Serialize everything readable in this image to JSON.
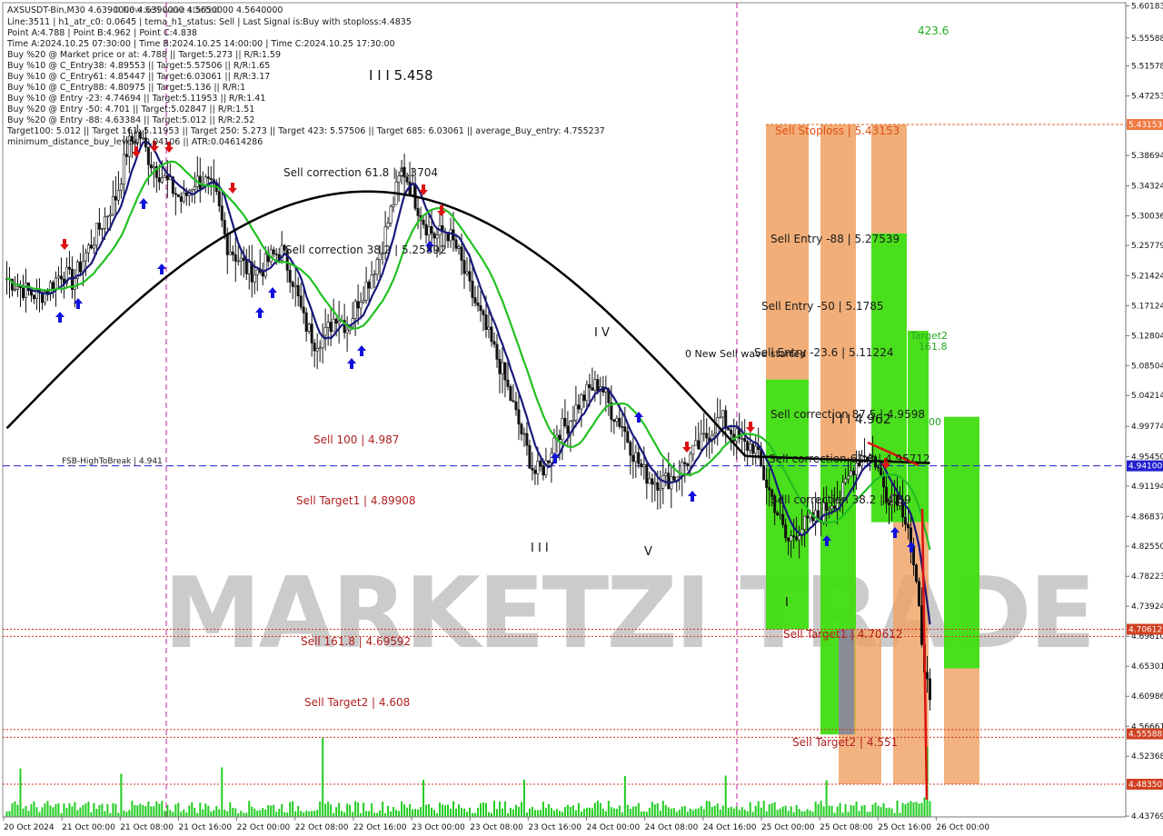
{
  "chart_data": {
    "type": "candlestick",
    "symbol_header": "AXSUSDT-Bin,M30  4.6390000 4.6390000 4.5650000 4.5640000",
    "overlay_title": "0 New Sell wave started",
    "info_lines": [
      "Line:3511 | h1_atr_c0: 0.0645 | tema_h1_status: Sell | Last Signal is:Buy with stoploss:4.4835",
      "Point A:4.788 | Point B:4.962 | Point C:4.838",
      "Time A:2024.10.25 07:30:00 | Time B:2024.10.25 14:00:00 | Time C:2024.10.25 17:30:00",
      "Buy %20 @ Market price or at: 4.788 || Target:5.273 || R/R:1.59",
      "Buy %10 @ C_Entry38: 4.89553 || Target:5.57506 || R/R:1.65",
      "Buy %10 @ C_Entry61: 4.85447 || Target:6.03061 || R/R:3.17",
      "Buy %10 @ C_Entry88: 4.80975 || Target:5.136 || R/R:1",
      "Buy %10 @ Entry -23: 4.74694 || Target:5.11953 || R/R:1.41",
      "Buy %20 @ Entry -50: 4.701 || Target:5.02847 || R/R:1.51",
      "Buy %20 @ Entry -88: 4.63384 || Target:5.012 || R/R:2.52",
      "Target100: 5.012 || Target 161: 5.11953 || Target 250: 5.273 || Target 423: 5.57506 || Target 685: 6.03061 || average_Buy_entry: 4.755237",
      "minimum_distance_buy_levels: 0.04106 || ATR:0.04614286"
    ],
    "y_axis": {
      "min": 4.4365,
      "max": 5.6065,
      "ticks": [
        "5.60183",
        "5.55588",
        "5.51578",
        "5.47253",
        "5.42928",
        "5.38694",
        "5.34324",
        "5.30036",
        "5.25779",
        "5.21424",
        "5.17124",
        "5.12804",
        "5.08504",
        "5.04214",
        "4.99774",
        "4.95450",
        "4.91194",
        "4.86837",
        "4.82550",
        "4.78223",
        "4.73924",
        "4.69610",
        "4.65301",
        "4.60986",
        "4.56661",
        "4.52368",
        "4.48063",
        "4.43769"
      ]
    },
    "highlight_prices": [
      {
        "label": "5.43153",
        "value": 5.43153,
        "color": "#f07840"
      },
      {
        "label": "4.94100",
        "value": 4.941,
        "color": "#2020d0"
      },
      {
        "label": "4.70612",
        "value": 4.70612,
        "color": "#d04020"
      },
      {
        "label": "4.55588",
        "value": 4.55588,
        "color": "#d04020"
      },
      {
        "label": "4.48350",
        "value": 4.4835,
        "color": "#d04020"
      }
    ],
    "x_axis": {
      "labels": [
        "20 Oct 2024",
        "21 Oct 00:00",
        "21 Oct 08:00",
        "21 Oct 16:00",
        "22 Oct 00:00",
        "22 Oct 08:00",
        "22 Oct 16:00",
        "23 Oct 00:00",
        "23 Oct 08:00",
        "23 Oct 16:00",
        "24 Oct 00:00",
        "24 Oct 08:00",
        "24 Oct 16:00",
        "25 Oct 00:00",
        "25 Oct 08:00",
        "25 Oct 16:00",
        "26 Oct 00:00"
      ]
    },
    "price_path": [
      5.21,
      5.2,
      5.19,
      5.185,
      5.2,
      5.22,
      5.205,
      5.24,
      5.27,
      5.3,
      5.33,
      5.4,
      5.42,
      5.38,
      5.36,
      5.34,
      5.32,
      5.35,
      5.35,
      5.33,
      5.26,
      5.24,
      5.22,
      5.22,
      5.24,
      5.25,
      5.21,
      5.15,
      5.12,
      5.13,
      5.16,
      5.14,
      5.18,
      5.21,
      5.25,
      5.31,
      5.37,
      5.33,
      5.29,
      5.27,
      5.28,
      5.25,
      5.2,
      5.16,
      5.12,
      5.08,
      5.03,
      4.98,
      4.93,
      4.94,
      4.99,
      5.0,
      5.03,
      5.05,
      5.06,
      5.02,
      5.0,
      4.96,
      4.93,
      4.92,
      4.92,
      4.93,
      4.95,
      4.97,
      4.99,
      5.01,
      4.99,
      4.97,
      4.97,
      4.92,
      4.88,
      4.83,
      4.85,
      4.86,
      4.87,
      4.89,
      4.9,
      4.94,
      4.96,
      4.95,
      4.9,
      4.9,
      4.86,
      4.73,
      4.59
    ],
    "price_levels": [
      {
        "text": "Sell Stoploss | 5.43153",
        "value": 5.43153,
        "color": "#e05010"
      },
      {
        "text": "Sell Entry -88 | 5.27539",
        "value": 5.27539,
        "color": "#1a1a1a"
      },
      {
        "text": "Sell Entry -50 | 5.1785",
        "value": 5.1785,
        "color": "#1a1a1a"
      },
      {
        "text": "Sell Entry -23.6 | 5.11224",
        "value": 5.11224,
        "color": "#1a1a1a"
      },
      {
        "text": "Sell correction 87.5 | 4.9598",
        "value": 4.9598,
        "color": "#1a1a1a"
      },
      {
        "text": "Sell correction 61.8 | 4.95712",
        "value": 4.95712,
        "color": "#1a1a1a"
      },
      {
        "text": "Sell correction 38.2 | 4.89",
        "value": 4.89,
        "color": "#1a1a1a"
      },
      {
        "text": "Sell Target1 | 4.70612",
        "value": 4.70612,
        "color": "#b02020"
      },
      {
        "text": "Sell Target2 | 4.551",
        "value": 4.551,
        "color": "#b02020"
      },
      {
        "text": "Sell 100 | 4.987",
        "value": 4.987,
        "color": "#b02020"
      },
      {
        "text": "Sell Target1 | 4.89908",
        "value": 4.89908,
        "color": "#b02020"
      },
      {
        "text": "Sell 161.8 | 4.69592",
        "value": 4.69592,
        "color": "#b02020"
      },
      {
        "text": "Sell Target2 | 4.608",
        "value": 4.608,
        "color": "#b02020"
      },
      {
        "text": "Sell correction 61.8 | 5.3704",
        "value": 5.3704,
        "color": "#1a1a1a"
      },
      {
        "text": "Sell correction 38.2 | 5.25892",
        "value": 5.25892,
        "color": "#1a1a1a"
      },
      {
        "text": "FSB-HighToBreak | 4.941",
        "value": 4.941,
        "color": "#1a1a1a"
      }
    ],
    "wave_labels": [
      "I I I 5.458",
      "I V",
      "I I I",
      "V",
      "I I I 4.962",
      "I"
    ],
    "misc_labels": [
      "423.6",
      "Target2",
      "161.8",
      "00",
      "0 New Sell wave started"
    ],
    "watermark": "MARKETZI TRADE",
    "series": [
      {
        "name": "",
        "color": "#19197a"
      },
      {
        "name": "",
        "color": "#22c022"
      },
      {
        "name": "",
        "color": "#000000"
      }
    ],
    "colors": {
      "bull": "#1a1a1a",
      "bear": "#1a1a1a",
      "zone_orange": "#f0a060",
      "zone_green": "#40dd10",
      "volume": "#22cc22",
      "accent_red": "#dd1111",
      "accent_blue": "#1111dd"
    }
  }
}
